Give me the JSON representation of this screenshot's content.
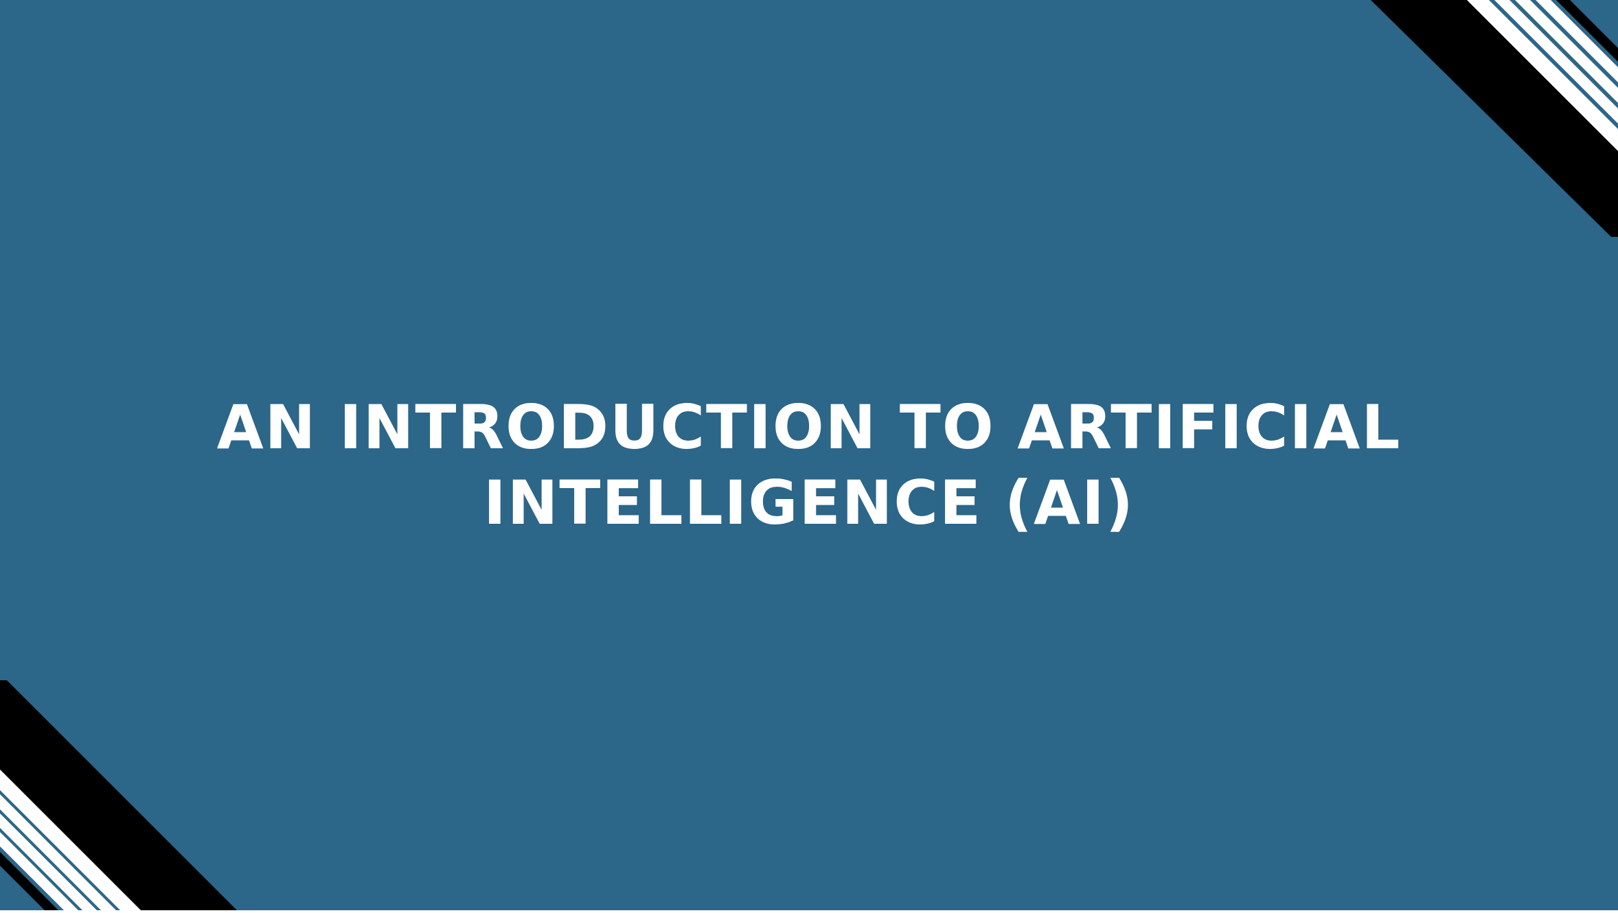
{
  "slide": {
    "title_line_1": "AN INTRODUCTION TO ARTIFICIAL",
    "title_line_2": "INTELLIGENCE (AI)"
  },
  "colors": {
    "background": "#2c6689",
    "title_text": "#ffffff",
    "corner_band": "#000000",
    "corner_stripe": "#ffffff"
  }
}
